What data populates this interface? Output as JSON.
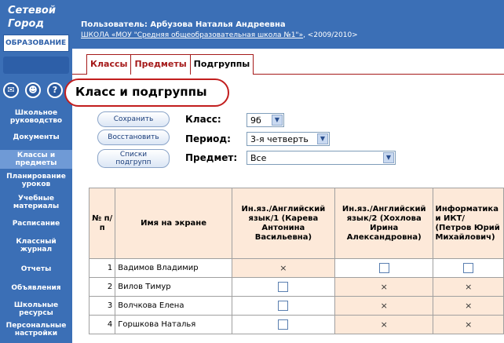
{
  "logo": {
    "line1": "Сетевой",
    "line2": "Город",
    "line3": "ОБРАЗОВАНИЕ"
  },
  "sidebar": {
    "icons": [
      "mail-icon",
      "users-icon",
      "help-icon"
    ],
    "items": [
      {
        "label": "Школьное руководство"
      },
      {
        "label": "Документы"
      },
      {
        "label": "Классы и предметы",
        "active": true
      },
      {
        "label": "Планирование уроков"
      },
      {
        "label": "Учебные материалы"
      },
      {
        "label": "Расписание"
      },
      {
        "label": "Классный журнал"
      },
      {
        "label": "Отчеты"
      },
      {
        "label": "Объявления"
      },
      {
        "label": "Школьные ресурсы"
      },
      {
        "label": "Персональные настройки"
      }
    ]
  },
  "header": {
    "user": "Пользователь: Арбузова Наталья Андреевна",
    "school_prefix": "ШКОЛА",
    "school_link": "ШКОЛА «МОУ \"Средняя общеобразовательная школа №1\"»",
    "years": ", <2009/2010>"
  },
  "tabs": [
    "Классы",
    "Предметы",
    "Подгруппы"
  ],
  "active_tab": "Подгруппы",
  "page_title": "Класс и подгруппы",
  "buttons": {
    "save": "Сохранить",
    "restore": "Восстановить",
    "lists": "Списки подгрупп"
  },
  "filters": {
    "class_label": "Класс:",
    "class_value": "9б",
    "period_label": "Период:",
    "period_value": "3-я четверть",
    "subject_label": "Предмет:",
    "subject_value": "Все"
  },
  "table": {
    "headers": {
      "num": "№ п/п",
      "name": "Имя на экране",
      "g1": "Ин.яз./Английский язык/1 (Карева Антонина Васильевна)",
      "g2": "Ин.яз./Английский язык/2 (Хохлова Ирина Александровна)",
      "g3": "Информатика и ИКТ/ (Петров Юрий Михайлович)"
    },
    "rows": [
      {
        "num": "1",
        "name": "Вадимов Владимир",
        "g1": "x",
        "g2": "box",
        "g3": "box"
      },
      {
        "num": "2",
        "name": "Вилов Тимур",
        "g1": "box",
        "g2": "x",
        "g3": "x"
      },
      {
        "num": "3",
        "name": "Волчкова Елена",
        "g1": "box",
        "g2": "x",
        "g3": "x"
      },
      {
        "num": "4",
        "name": "Горшкова Наталья",
        "g1": "box",
        "g2": "x",
        "g3": "x"
      }
    ]
  }
}
